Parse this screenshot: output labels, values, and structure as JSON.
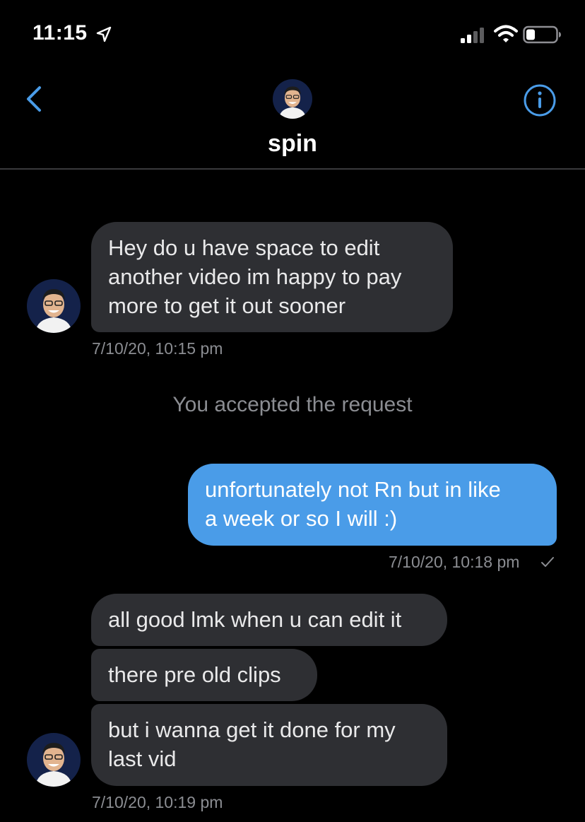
{
  "status_bar": {
    "time": "11:15",
    "icons": [
      "location-arrow-icon",
      "signal-icon",
      "wifi-icon",
      "battery-icon"
    ]
  },
  "header": {
    "contact_name": "spin",
    "icons": [
      "back-chevron-icon",
      "info-icon"
    ]
  },
  "colors": {
    "background": "#000000",
    "incoming_bubble": "#2e2f33",
    "outgoing_bubble": "#4a9ce8",
    "accent": "#4a9ce8",
    "muted_text": "#8b8d92"
  },
  "messages": [
    {
      "direction": "incoming",
      "text": "Hey do u have space to edit\nanother video im happy to pay\nmore to get it out sooner",
      "timestamp": "7/10/20, 10:15 pm"
    },
    {
      "direction": "system",
      "text": "You accepted the request"
    },
    {
      "direction": "outgoing",
      "text": "unfortunately not Rn but in like\na week or so I will :)",
      "timestamp": "7/10/20, 10:18 pm",
      "status": "sent"
    },
    {
      "direction": "incoming",
      "text": "all good lmk when u can edit it"
    },
    {
      "direction": "incoming",
      "text": "there pre old clips"
    },
    {
      "direction": "incoming",
      "text": "but i wanna get it done for my\nlast vid",
      "timestamp": "7/10/20, 10:19 pm"
    }
  ]
}
